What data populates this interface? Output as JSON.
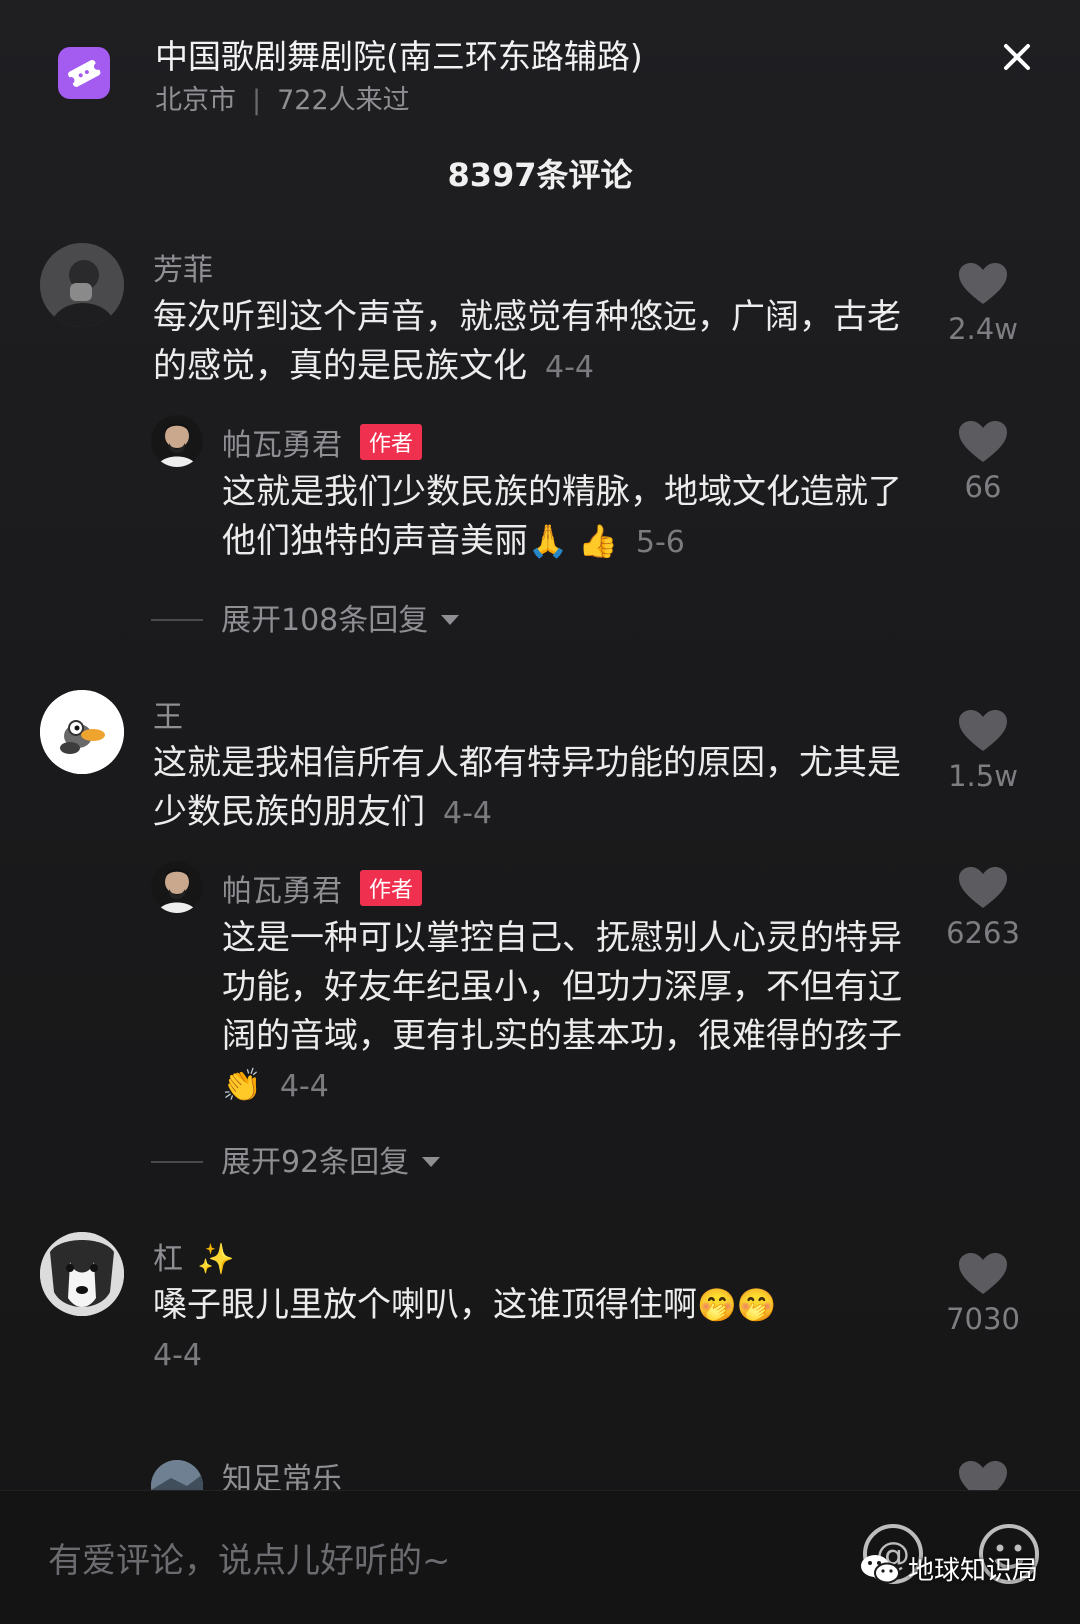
{
  "location": {
    "name": "中国歌剧舞剧院(南三环东路辅路)",
    "city": "北京市",
    "separator": "|",
    "visitors": "722人来过"
  },
  "comments_header": {
    "count_label": "8397条评论"
  },
  "comments": [
    {
      "username": "芳菲",
      "text": "每次听到这个声音，就感觉有种悠远，广阔，古老的感觉，真的是民族文化",
      "date": "4-4",
      "likes": "2.4w",
      "reply": {
        "username": "帕瓦勇君",
        "badge": "作者",
        "text": "这就是我们少数民族的精脉，地域文化造就了他们独特的声音美丽",
        "emoji": "🙏 👍",
        "date": "5-6",
        "likes": "66"
      },
      "expand_label": "展开108条回复"
    },
    {
      "username": "王",
      "text": "这就是我相信所有人都有特异功能的原因，尤其是少数民族的朋友们",
      "date": "4-4",
      "likes": "1.5w",
      "reply": {
        "username": "帕瓦勇君",
        "badge": "作者",
        "text": "这是一种可以掌控自己、抚慰别人心灵的特异功能，好友年纪虽小，但功力深厚，不但有辽阔的音域，更有扎实的基本功，很难得的孩子",
        "emoji": "👏",
        "date": "4-4",
        "likes": "6263"
      },
      "expand_label": "展开92条回复"
    },
    {
      "username": "杠",
      "username_emoji": "✨",
      "text": "嗓子眼儿里放个喇叭，这谁顶得住啊",
      "emoji": "🤭🤭",
      "date": "4-4",
      "likes": "7030"
    },
    {
      "username": "知足常乐"
    }
  ],
  "input": {
    "placeholder": "有爱评论，说点儿好听的~",
    "mention_symbol": "@"
  },
  "watermark": {
    "text": "地球知识局"
  },
  "colors": {
    "badge": "#f0304f",
    "ticket_icon": "#a45cf0"
  }
}
